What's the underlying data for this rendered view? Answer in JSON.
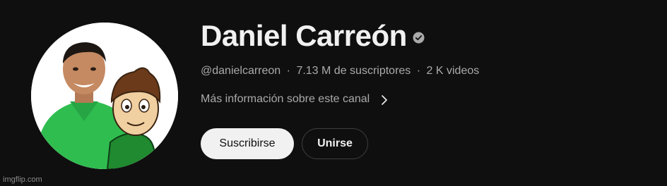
{
  "channel": {
    "name": "Daniel Carreón",
    "handle": "@danielcarreon",
    "subscribers": "7.13 M de suscriptores",
    "videos": "2 K videos",
    "separator": "·",
    "more_info": "Más información sobre este canal"
  },
  "buttons": {
    "subscribe": "Suscribirse",
    "join": "Unirse"
  },
  "icons": {
    "verified": "verified-check-icon",
    "chevron": "chevron-right-icon"
  },
  "watermark": "imgflip.com",
  "colors": {
    "background": "#0f0f0f",
    "text_primary": "#f1f1f1",
    "text_secondary": "#aaaaaa",
    "subscribe_bg": "#f1f1f1",
    "shirt_green": "#2fbd4f"
  }
}
